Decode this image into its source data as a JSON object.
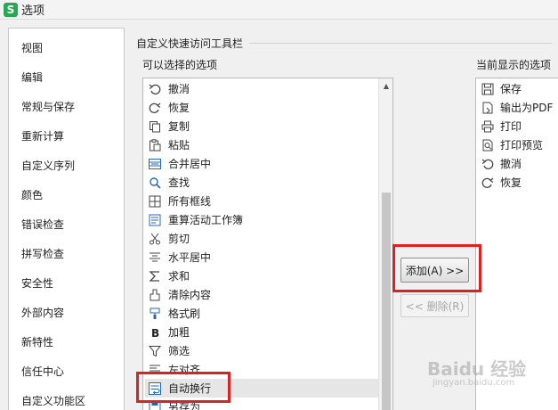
{
  "window": {
    "title": "选项",
    "app_icon_letter": "S",
    "app_icon_color": "#27a853"
  },
  "nav": {
    "items": [
      "视图",
      "编辑",
      "常规与保存",
      "重新计算",
      "自定义序列",
      "颜色",
      "错误检查",
      "拼写检查",
      "安全性",
      "外部内容",
      "新特性",
      "信任中心",
      "自定义功能区"
    ]
  },
  "quick_access": {
    "group_label": "自定义快速访问工具栏",
    "available_label": "可以选择的选项",
    "current_label": "当前显示的选项",
    "available": [
      {
        "label": "撤消",
        "icon": "undo-icon"
      },
      {
        "label": "恢复",
        "icon": "redo-icon"
      },
      {
        "label": "复制",
        "icon": "copy-icon"
      },
      {
        "label": "粘贴",
        "icon": "paste-icon"
      },
      {
        "label": "合并居中",
        "icon": "merge-center-icon"
      },
      {
        "label": "查找",
        "icon": "search-icon"
      },
      {
        "label": "所有框线",
        "icon": "all-borders-icon"
      },
      {
        "label": "重算活动工作簿",
        "icon": "recalculate-icon"
      },
      {
        "label": "剪切",
        "icon": "cut-icon"
      },
      {
        "label": "水平居中",
        "icon": "align-center-icon"
      },
      {
        "label": "求和",
        "icon": "sum-icon"
      },
      {
        "label": "清除内容",
        "icon": "clear-content-icon"
      },
      {
        "label": "格式刷",
        "icon": "format-painter-icon"
      },
      {
        "label": "加粗",
        "icon": "bold-icon"
      },
      {
        "label": "筛选",
        "icon": "filter-icon"
      },
      {
        "label": "左对齐",
        "icon": "align-left-icon"
      },
      {
        "label": "自动换行",
        "icon": "wrap-text-icon"
      },
      {
        "label": "另存为",
        "icon": "save-as-icon"
      }
    ],
    "selected_item": "自动换行",
    "current": [
      {
        "label": "保存",
        "icon": "save-icon"
      },
      {
        "label": "输出为PDF",
        "icon": "pdf-export-icon"
      },
      {
        "label": "打印",
        "icon": "print-icon"
      },
      {
        "label": "打印预览",
        "icon": "print-preview-icon"
      },
      {
        "label": "撤消",
        "icon": "undo-icon"
      },
      {
        "label": "恢复",
        "icon": "redo-icon"
      }
    ],
    "add_button": "添加(A) >>",
    "remove_button": "<< 删除(R)"
  },
  "highlight_color": "#e02020",
  "watermark": {
    "text": "Baidu 经验",
    "sub": "jingyan.baidu.com"
  }
}
